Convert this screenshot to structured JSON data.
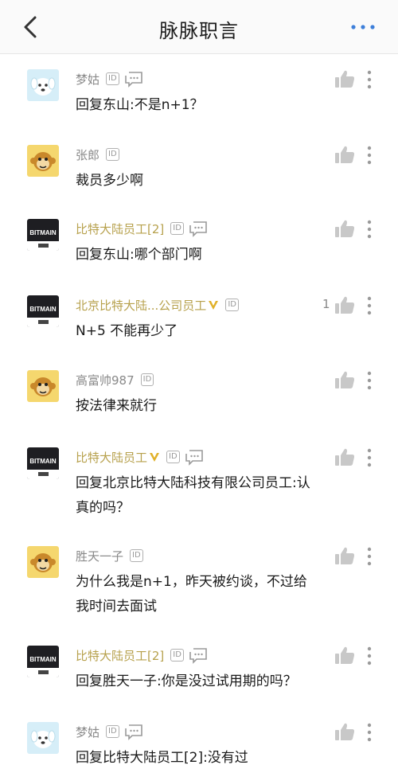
{
  "header": {
    "title": "脉脉职言"
  },
  "comments": [
    {
      "avatar": "dog-avatar",
      "name": "梦姑",
      "name_style": "gray",
      "id_badge": "ID",
      "has_chat": true,
      "text": "回复东山:不是n+1？",
      "likes": ""
    },
    {
      "avatar": "monkey-avatar",
      "name": "张郎",
      "name_style": "gray",
      "id_badge": "ID",
      "has_chat": false,
      "text": "裁员多少啊",
      "likes": ""
    },
    {
      "avatar": "bitmain-logo",
      "name": "比特大陆员工[2]",
      "name_style": "verified",
      "id_badge": "ID",
      "has_chat": true,
      "text": "回复东山:哪个部门啊",
      "likes": ""
    },
    {
      "avatar": "bitmain-logo",
      "name": "北京比特大陆...公司员工",
      "name_style": "verified",
      "verified_mark": true,
      "id_badge": "ID",
      "has_chat": false,
      "text": "N+5 不能再少了",
      "likes": "1"
    },
    {
      "avatar": "monkey-avatar",
      "name": "高富帅987",
      "name_style": "gray",
      "id_badge": "ID",
      "has_chat": false,
      "text": "按法律来就行",
      "likes": ""
    },
    {
      "avatar": "bitmain-logo",
      "name": "比特大陆员工",
      "name_style": "verified",
      "verified_mark": true,
      "id_badge": "ID",
      "has_chat": true,
      "text": "回复北京比特大陆科技有限公司员工:认\n真的吗？",
      "likes": ""
    },
    {
      "avatar": "monkey-avatar",
      "name": "胜天一子",
      "name_style": "gray",
      "id_badge": "ID",
      "has_chat": false,
      "text": "为什么我是n+1，昨天被约谈，不过给\n我时间去面试",
      "likes": ""
    },
    {
      "avatar": "bitmain-logo",
      "name": "比特大陆员工[2]",
      "name_style": "verified",
      "id_badge": "ID",
      "has_chat": true,
      "text": "回复胜天一子:你是没过试用期的吗？",
      "likes": ""
    },
    {
      "avatar": "dog-avatar",
      "name": "梦姑",
      "name_style": "gray",
      "id_badge": "ID",
      "has_chat": true,
      "text": "回复比特大陆员工[2]:没有过",
      "likes": ""
    }
  ],
  "logo_text": "BITMAIN",
  "colors": {
    "verified_name": "#b7a14d",
    "gray_name": "#8a8a8a",
    "icon_gray": "#c8c8c8",
    "accent_blue": "#3d7fd9"
  }
}
